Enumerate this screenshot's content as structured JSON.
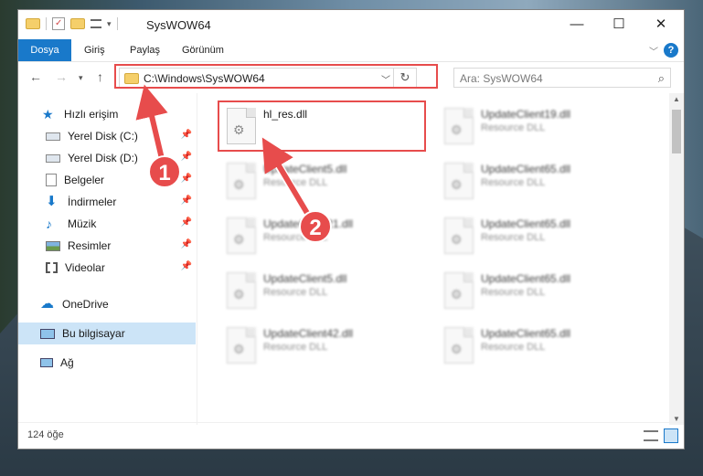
{
  "window": {
    "title": "SysWOW64",
    "controls": {
      "minimize": "—",
      "maximize": "☐",
      "close": "✕"
    }
  },
  "ribbon": {
    "tabs": [
      "Dosya",
      "Giriş",
      "Paylaş",
      "Görünüm"
    ],
    "help": "?"
  },
  "nav": {
    "address": "C:\\Windows\\SysWOW64",
    "search_placeholder": "Ara: SysWOW64"
  },
  "sidebar": {
    "items": [
      {
        "label": "Hızlı erişim",
        "icon": "star-icon"
      },
      {
        "label": "Yerel Disk (C:)",
        "icon": "drive-icon"
      },
      {
        "label": "Yerel Disk (D:)",
        "icon": "drive-icon"
      },
      {
        "label": "Belgeler",
        "icon": "documents-icon"
      },
      {
        "label": "İndirmeler",
        "icon": "download-icon"
      },
      {
        "label": "Müzik",
        "icon": "music-icon"
      },
      {
        "label": "Resimler",
        "icon": "pictures-icon"
      },
      {
        "label": "Videolar",
        "icon": "videos-icon"
      },
      {
        "label": "OneDrive",
        "icon": "cloud-icon"
      },
      {
        "label": "Bu bilgisayar",
        "icon": "computer-icon"
      },
      {
        "label": "Ağ",
        "icon": "network-icon"
      }
    ]
  },
  "files": [
    {
      "name": "hl_res.dll",
      "type": ""
    },
    {
      "name": "UpdateClient19.dll",
      "type": "Resource DLL"
    },
    {
      "name": "UpdateClient5.dll",
      "type": "Resource DLL"
    },
    {
      "name": "UpdateClient65.dll",
      "type": "Resource DLL"
    },
    {
      "name": "UpdateClient21.dll",
      "type": "Resource DLL"
    },
    {
      "name": "UpdateClient65.dll",
      "type": "Resource DLL"
    },
    {
      "name": "UpdateClient5.dll",
      "type": "Resource DLL"
    },
    {
      "name": "UpdateClient65.dll",
      "type": "Resource DLL"
    },
    {
      "name": "UpdateClient42.dll",
      "type": "Resource DLL"
    },
    {
      "name": "UpdateClient65.dll",
      "type": "Resource DLL"
    }
  ],
  "status": {
    "count_text": "124 öğe"
  },
  "annotations": {
    "step1": "1",
    "step2": "2"
  },
  "colors": {
    "accent": "#1979ca",
    "highlight": "#e74c4c",
    "selected": "#cce4f7"
  }
}
